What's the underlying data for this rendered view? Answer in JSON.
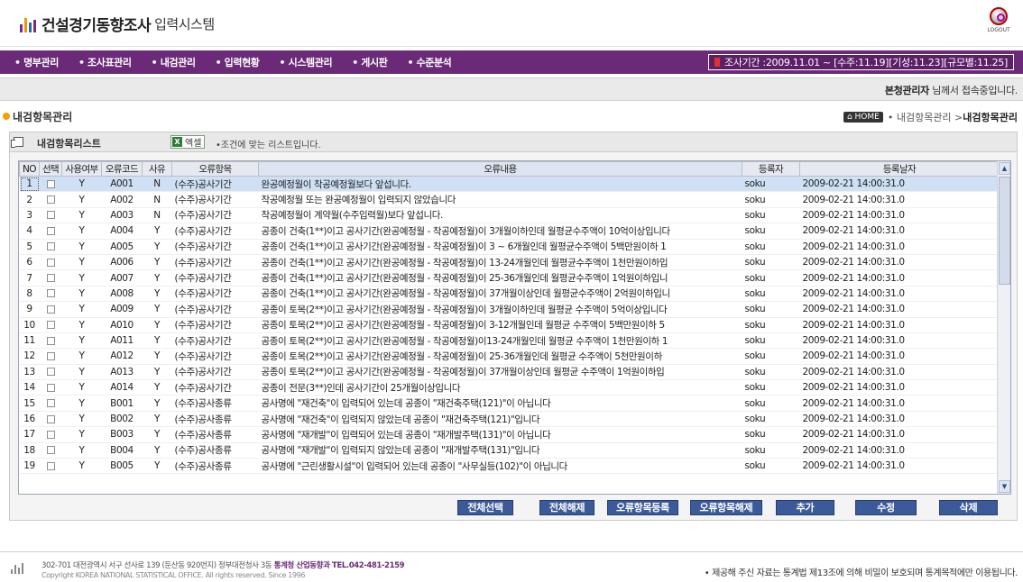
{
  "header": {
    "title_bold": "건설경기동향조사",
    "title_rest": "입력시스템",
    "logout_label": "LOGOUT"
  },
  "nav": {
    "items": [
      "명부관리",
      "조사표관리",
      "내검관리",
      "입력현황",
      "시스템관리",
      "게시판",
      "수준분석"
    ],
    "survey_period": "조사기간 :2009.11.01 ~ [수주:11.19][기성:11.23][규모별:11.25]"
  },
  "greeting": {
    "user": "본청관리자",
    "text": " 님께서 접속중입니다."
  },
  "page": {
    "title": "내검항목관리",
    "breadcrumb_home": "HOME",
    "breadcrumb_mid": "• 내검항목관리 > ",
    "breadcrumb_current": "내검항목관리"
  },
  "list": {
    "title": "내검항목리스트",
    "excel_label": "엑셀",
    "note": "•조건에 맞는 리스트입니다."
  },
  "table": {
    "columns": [
      "NO",
      "선택",
      "사용여부",
      "오류코드",
      "사유",
      "오류항목",
      "오류내용",
      "등록자",
      "등록날자"
    ],
    "rows": [
      {
        "no": "1",
        "use": "Y",
        "code": "A001",
        "reason": "N",
        "item": "(수주)공사기간",
        "content": "완공예정월이 착공예정월보다 앞섭니다.",
        "user": "soku",
        "date": "2009-02-21 14:00:31.0"
      },
      {
        "no": "2",
        "use": "Y",
        "code": "A002",
        "reason": "N",
        "item": "(수주)공사기간",
        "content": "착공예정월 또는 완공예정월이 입력되지 않았습니다",
        "user": "soku",
        "date": "2009-02-21 14:00:31.0"
      },
      {
        "no": "3",
        "use": "Y",
        "code": "A003",
        "reason": "N",
        "item": "(수주)공사기간",
        "content": "착공예정월이 계약월(수주입력월)보다 앞섭니다.",
        "user": "soku",
        "date": "2009-02-21 14:00:31.0"
      },
      {
        "no": "4",
        "use": "Y",
        "code": "A004",
        "reason": "Y",
        "item": "(수주)공사기간",
        "content": "공종이 건축(1**)이고 공사기간(완공예정월 - 착공예정월)이 3개월이하인데 월평균수주액이 10억이상입니다",
        "user": "soku",
        "date": "2009-02-21 14:00:31.0"
      },
      {
        "no": "5",
        "use": "Y",
        "code": "A005",
        "reason": "Y",
        "item": "(수주)공사기간",
        "content": "공종이 건축(1**)이고 공사기간(완공예정월 - 착공예정월)이 3 ~ 6개월인데 월평균수주액이 5백만원이하 1",
        "user": "soku",
        "date": "2009-02-21 14:00:31.0"
      },
      {
        "no": "6",
        "use": "Y",
        "code": "A006",
        "reason": "Y",
        "item": "(수주)공사기간",
        "content": "공종이 건축(1**)이고 공사기간(완공예정월 - 착공예정월)이 13-24개월인데 월평균수주액이 1천만원이하입",
        "user": "soku",
        "date": "2009-02-21 14:00:31.0"
      },
      {
        "no": "7",
        "use": "Y",
        "code": "A007",
        "reason": "Y",
        "item": "(수주)공사기간",
        "content": "공종이 건축(1**)이고 공사기간(완공예정월 - 착공예정월)이 25-36개월인데 월평균수주액이 1억원이하입니",
        "user": "soku",
        "date": "2009-02-21 14:00:31.0"
      },
      {
        "no": "8",
        "use": "Y",
        "code": "A008",
        "reason": "Y",
        "item": "(수주)공사기간",
        "content": "공종이 건축(1**)이고 공사기간(완공예정월 - 착공예정월)이 37개월이상인데 월평균수주액이 2억원이하입니",
        "user": "soku",
        "date": "2009-02-21 14:00:31.0"
      },
      {
        "no": "9",
        "use": "Y",
        "code": "A009",
        "reason": "Y",
        "item": "(수주)공사기간",
        "content": "공종이 토목(2**)이고 공사기간(완공예정월 - 착공예정월)이 3개월이하인데 월평균 수주액이 5억이상입니다",
        "user": "soku",
        "date": "2009-02-21 14:00:31.0"
      },
      {
        "no": "10",
        "use": "Y",
        "code": "A010",
        "reason": "Y",
        "item": "(수주)공사기간",
        "content": "공종이 토목(2**)이고 공사기간(완공예정월 - 착공예정월)이 3-12개월인데 월평균 수주액이 5백만원이하 5",
        "user": "soku",
        "date": "2009-02-21 14:00:31.0"
      },
      {
        "no": "11",
        "use": "Y",
        "code": "A011",
        "reason": "Y",
        "item": "(수주)공사기간",
        "content": "공종이 토목(2**)이고 공사기간(완공예정월 - 착공예정월)이13-24개월인데 월평균 수주액이 1천만원이하 1",
        "user": "soku",
        "date": "2009-02-21 14:00:31.0"
      },
      {
        "no": "12",
        "use": "Y",
        "code": "A012",
        "reason": "Y",
        "item": "(수주)공사기간",
        "content": "공종이 토목(2**)이고 공사기간(완공예정월 - 착공예정월)이 25-36개월인데 월평균 수주액이 5천만원이하",
        "user": "soku",
        "date": "2009-02-21 14:00:31.0"
      },
      {
        "no": "13",
        "use": "Y",
        "code": "A013",
        "reason": "Y",
        "item": "(수주)공사기간",
        "content": "공종이 토목(2**)이고 공사기간(완공예정월 - 착공예정월)이 37개월이상인데 월평균 수주액이 1억원이하입",
        "user": "soku",
        "date": "2009-02-21 14:00:31.0"
      },
      {
        "no": "14",
        "use": "Y",
        "code": "A014",
        "reason": "Y",
        "item": "(수주)공사기간",
        "content": "공종이 전문(3**)인데 공사기간이 25개월이상입니다",
        "user": "soku",
        "date": "2009-02-21 14:00:31.0"
      },
      {
        "no": "15",
        "use": "Y",
        "code": "B001",
        "reason": "Y",
        "item": "(수주)공사종류",
        "content": "공사명에 \"재건축\"이 입력되어 있는데 공종이 \"재건축주택(121)\"이 아닙니다",
        "user": "soku",
        "date": "2009-02-21 14:00:31.0"
      },
      {
        "no": "16",
        "use": "Y",
        "code": "B002",
        "reason": "Y",
        "item": "(수주)공사종류",
        "content": "공사명에 \"재건축\"이 입력되지 않았는데 공종이 \"재건축주택(121)\"입니다",
        "user": "soku",
        "date": "2009-02-21 14:00:31.0"
      },
      {
        "no": "17",
        "use": "Y",
        "code": "B003",
        "reason": "Y",
        "item": "(수주)공사종류",
        "content": "공사명에 \"재개발\"이 입력되어 있는데 공종이 \"재개발주택(131)\"이 아닙니다",
        "user": "soku",
        "date": "2009-02-21 14:00:31.0"
      },
      {
        "no": "18",
        "use": "Y",
        "code": "B004",
        "reason": "Y",
        "item": "(수주)공사종류",
        "content": "공사명에 \"재개발\"이 입력되지 않았는데 공종이 \"재개발주택(131)\"입니다",
        "user": "soku",
        "date": "2009-02-21 14:00:31.0"
      },
      {
        "no": "19",
        "use": "Y",
        "code": "B005",
        "reason": "Y",
        "item": "(수주)공사종류",
        "content": "공사명에 \"근린생활시설\"이 입력되어 있는데 공종이 \"사무실등(102)\"이 아닙니다",
        "user": "soku",
        "date": "2009-02-21 14:00:31.0"
      }
    ]
  },
  "buttons": {
    "select_all": "전체선택",
    "deselect_all": "전체해제",
    "register": "오류항목등록",
    "unregister": "오류항목해제",
    "add": "추가",
    "edit": "수정",
    "delete": "삭제"
  },
  "footer": {
    "address": "302-701 대전광역시 서구 선사로 139 (둔산동 920번지) 정부대전청사 3동 ",
    "org": "통계청 산업동향과 TEL.042-481-2159",
    "copyright": "Copyright KOREA NATIONAL STATISTICAL OFFICE. All rights reserved. Since 1996",
    "notice": "• 제공해 주신 자료는 통계법 제13조에 의해 비밀이 보호되며 통계목적에만 이용됩니다."
  },
  "colors": {
    "nav_bg": "#6b2a78",
    "button_bg": "#3c5a9a",
    "selected_row": "#cfe0f4",
    "title_dot": "#f5a000"
  }
}
